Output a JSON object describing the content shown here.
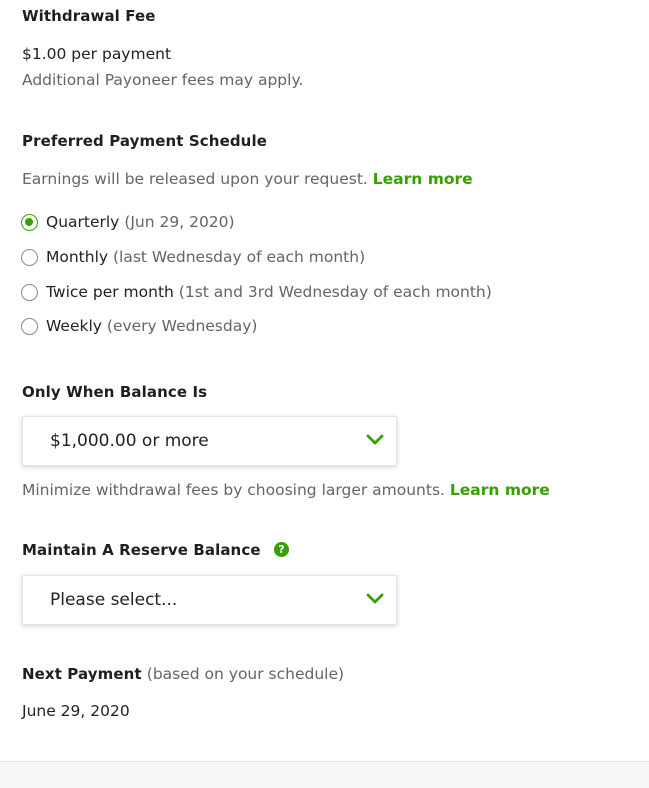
{
  "withdrawal_fee": {
    "title": "Withdrawal Fee",
    "amount": "$1.00 per payment",
    "note": "Additional Payoneer fees may apply."
  },
  "schedule": {
    "title": "Preferred Payment Schedule",
    "description": "Earnings will be released upon your request.",
    "learn_more": "Learn more",
    "options": [
      {
        "label": "Quarterly",
        "detail": "(Jun 29, 2020)",
        "selected": true
      },
      {
        "label": "Monthly",
        "detail": "(last Wednesday of each month)",
        "selected": false
      },
      {
        "label": "Twice per month",
        "detail": "(1st and 3rd Wednesday of each month)",
        "selected": false
      },
      {
        "label": "Weekly",
        "detail": "(every Wednesday)",
        "selected": false
      }
    ]
  },
  "balance": {
    "title": "Only When Balance Is",
    "selected_value": "$1,000.00 or more",
    "hint": "Minimize withdrawal fees by choosing larger amounts.",
    "learn_more": "Learn more"
  },
  "reserve": {
    "title": "Maintain A Reserve Balance",
    "help_icon": "?",
    "placeholder": "Please select..."
  },
  "next_payment": {
    "title": "Next Payment",
    "qualifier": "(based on your schedule)",
    "date": "June 29, 2020"
  },
  "colors": {
    "accent": "#37a000",
    "text": "#222222",
    "muted": "#656565"
  },
  "icons": {
    "radio_selected": "radio-checked-icon",
    "radio_unselected": "radio-unchecked-icon",
    "dropdown": "chevron-down-icon",
    "help": "question-circle-icon"
  }
}
